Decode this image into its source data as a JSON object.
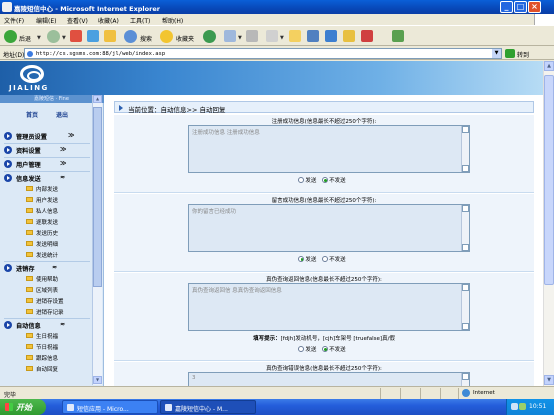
{
  "window": {
    "title": "嘉陵短信中心 - Microsoft Internet Explorer"
  },
  "menu": [
    "文件(F)",
    "编辑(E)",
    "查看(V)",
    "收藏(A)",
    "工具(T)",
    "帮助(H)"
  ],
  "toolbar": {
    "back": "后退",
    "search": "搜索",
    "favorites": "收藏夹"
  },
  "address": {
    "label": "地址(D)",
    "url": "http://cs.sgsms.com:88/jl/web/index.asp",
    "go": "转到"
  },
  "banner": {
    "logo_text": "JIALING",
    "sub": "嘉陵短信 · Fine"
  },
  "left_nav": {
    "strip_text": "嘉陵短信 · Fine",
    "links": [
      "首页",
      "退出"
    ],
    "groups": [
      {
        "label": "管理员设置",
        "expanded": false,
        "items": []
      },
      {
        "label": "资料设置",
        "expanded": false,
        "items": []
      },
      {
        "label": "用户管理",
        "expanded": false,
        "items": []
      },
      {
        "label": "信息发送",
        "expanded": true,
        "items": [
          "内部发送",
          "用户发送",
          "私人信息",
          "逐联发送",
          "发送历史",
          "发送明细",
          "发送统计"
        ]
      },
      {
        "label": "进销存",
        "expanded": true,
        "items": [
          "使用帮助",
          "区域列表",
          "进销存设置",
          "进销存记录"
        ]
      },
      {
        "label": "自动信息",
        "expanded": true,
        "items": [
          "生日祝福",
          "节日祝福",
          "跟踪信息",
          "自动回复"
        ]
      }
    ]
  },
  "content": {
    "breadcrumb": "当前位置：自动信息>> 自动回复",
    "sections": [
      {
        "label": "注册成功信息(信息最长不超过250个字符):",
        "value": "注册成功信息 注册成功信息",
        "options": [
          "发送",
          "不发送"
        ],
        "selected": 1
      },
      {
        "label": "留言成功信息(信息最长不超过250个字符):",
        "value": "你的留言已经成功",
        "options": [
          "发送",
          "不发送"
        ],
        "selected": 0
      },
      {
        "label": "真伪查询返回信息(信息最长不超过250个字符):",
        "value": "真伪查询返回信 息真伪查询返回信息",
        "options": [
          "发送",
          "不发送"
        ],
        "selected": 1,
        "tip_bold": "填写提示：",
        "tip": "[fdjh]发动机号，[cjh]车架号 [truefalse]真/假"
      },
      {
        "label": "真伪查询错误信息(信息最长不超过250个字符):",
        "value": "3",
        "options": [],
        "selected": -1
      }
    ]
  },
  "status": {
    "done": "完毕",
    "zone": "Internet"
  },
  "taskbar": {
    "start": "开始",
    "tasks": [
      "短信应用 - Micro...",
      "嘉陵短信中心 - M..."
    ],
    "clock": "10:51"
  }
}
